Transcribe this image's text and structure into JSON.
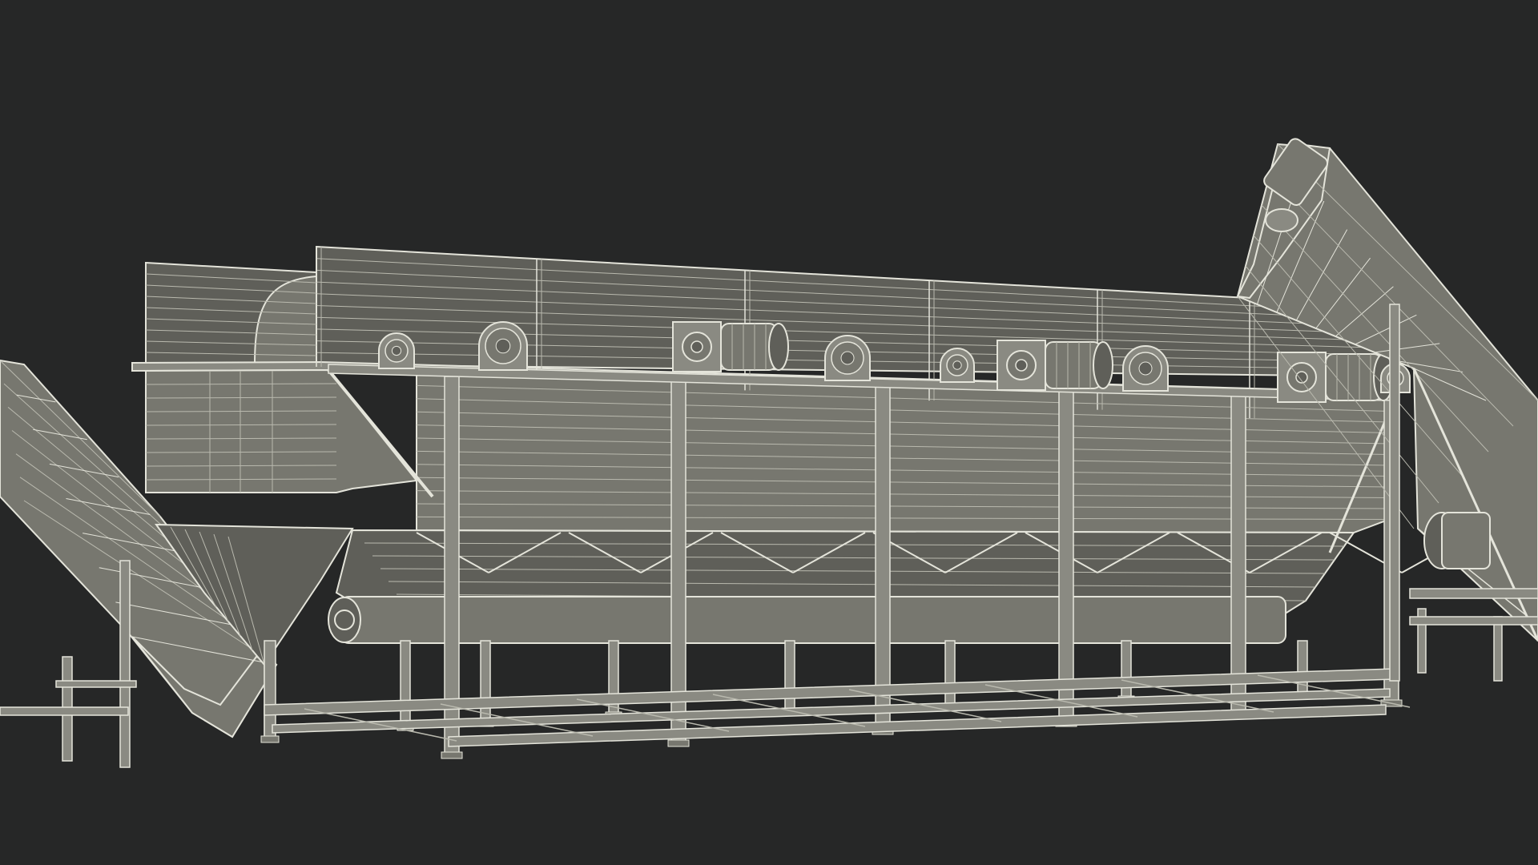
{
  "scene": {
    "subject": "wireframe-render-of-industrial-washing-tank-with-conveyors",
    "colors": {
      "background": "#262727",
      "surface": "#77776f",
      "surface_dark": "#5f5f59",
      "surface_light": "#8a8a82",
      "wire": "#e4e4da",
      "wire_dim": "#b9b9ae"
    },
    "components": [
      "left-inclined-conveyor",
      "main-washing-tank",
      "upper-paddle-housing",
      "drive-motor-assemblies",
      "bearing-blocks",
      "support-frame",
      "lower-discharge-screw",
      "right-inclined-conveyor"
    ]
  }
}
